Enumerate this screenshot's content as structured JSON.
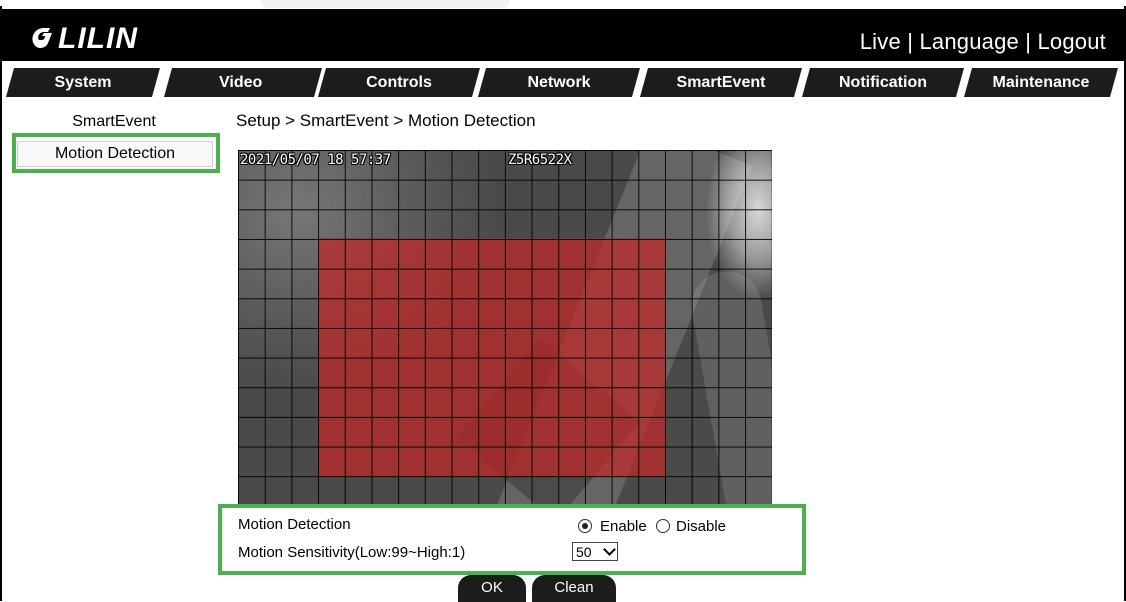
{
  "header": {
    "logo_text": "LILIN",
    "links": [
      "Live",
      "Language",
      "Logout"
    ],
    "separator": "|"
  },
  "nav": {
    "tabs": [
      "System",
      "Video",
      "Controls",
      "Network",
      "SmartEvent",
      "Notification",
      "Maintenance"
    ]
  },
  "sidebar": {
    "items": [
      "SmartEvent",
      "Motion Detection"
    ]
  },
  "breadcrumb": "Setup > SmartEvent > Motion Detection",
  "video": {
    "timestamp": "2021/05/07 18 57:37",
    "camera_model": "Z5R6522X",
    "grid_columns": 20,
    "grid_rows": 12
  },
  "settings": {
    "motion_detection_label": "Motion Detection",
    "enable_label": "Enable",
    "disable_label": "Disable",
    "motion_detection_value": "Enable",
    "sensitivity_label": "Motion Sensitivity(Low:99~High:1)",
    "sensitivity_value": "50"
  },
  "buttons": {
    "ok": "OK",
    "clean": "Clean"
  },
  "colors": {
    "highlight_box": "#4caf50",
    "motion_area": "#c02828",
    "tab_background": "#1c1c1c"
  }
}
